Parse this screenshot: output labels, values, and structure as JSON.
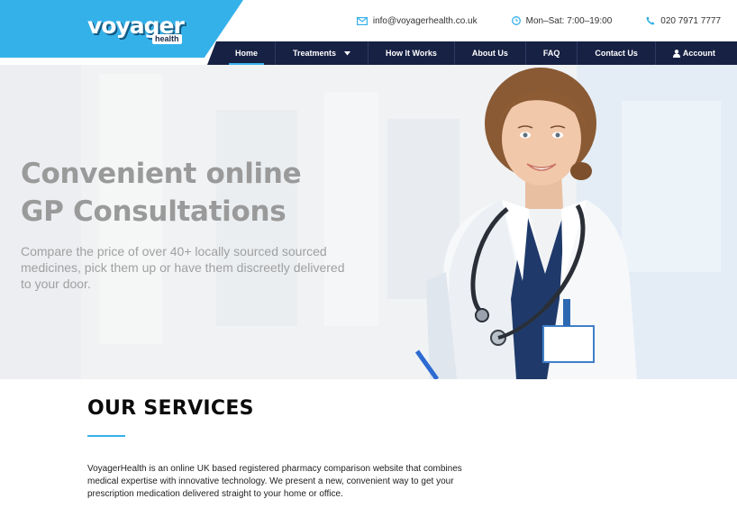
{
  "brand": {
    "logo_main": "voyager",
    "logo_sub": "health",
    "accent_color": "#35b1ea",
    "nav_color": "#172144"
  },
  "contact": {
    "email": "info@voyagerhealth.co.uk",
    "hours": "Mon–Sat: 7:00–19:00",
    "phone": "020 7971 7777",
    "email_icon": "envelope-icon",
    "hours_icon": "clock-icon",
    "phone_icon": "phone-icon"
  },
  "nav": {
    "items": [
      {
        "label": "Home",
        "active": true
      },
      {
        "label": "Treatments",
        "dropdown": true
      },
      {
        "label": "How It Works"
      },
      {
        "label": "About Us"
      },
      {
        "label": "FAQ"
      },
      {
        "label": "Contact Us"
      },
      {
        "label": "Account",
        "icon": "user-icon"
      }
    ]
  },
  "hero": {
    "title_line1": "Convenient online",
    "title_line2": "GP Consultations",
    "text": "Compare the price of over 40+ locally sourced sourced medicines, pick them up or have them discreetly delivered to your door."
  },
  "services": {
    "heading": "OUR SERVICES",
    "text": "VoyagerHealth is an online UK based registered pharmacy comparison website that combines medical expertise with innovative technology. We present a new, convenient way to get your prescription medication delivered straight to your home or office."
  }
}
